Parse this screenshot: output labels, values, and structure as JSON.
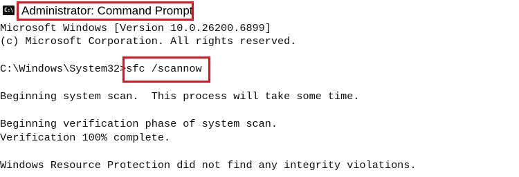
{
  "window": {
    "icon_text": "C:\\",
    "title": "Administrator: Command Prompt"
  },
  "console": {
    "version_line": "Microsoft Windows [Version 10.0.26200.6899]",
    "copyright_line": "(c) Microsoft Corporation. All rights reserved.",
    "prompt": "C:\\Windows\\System32>",
    "command": "sfc /scannow",
    "scan_begin": "Beginning system scan.  This process will take some time.",
    "verification_begin": "Beginning verification phase of system scan.",
    "verification_complete": "Verification 100% complete.",
    "result": "Windows Resource Protection did not find any integrity violations."
  },
  "colors": {
    "highlight": "#e0141e",
    "background": "#ffffff",
    "text": "#0c0c0c"
  }
}
